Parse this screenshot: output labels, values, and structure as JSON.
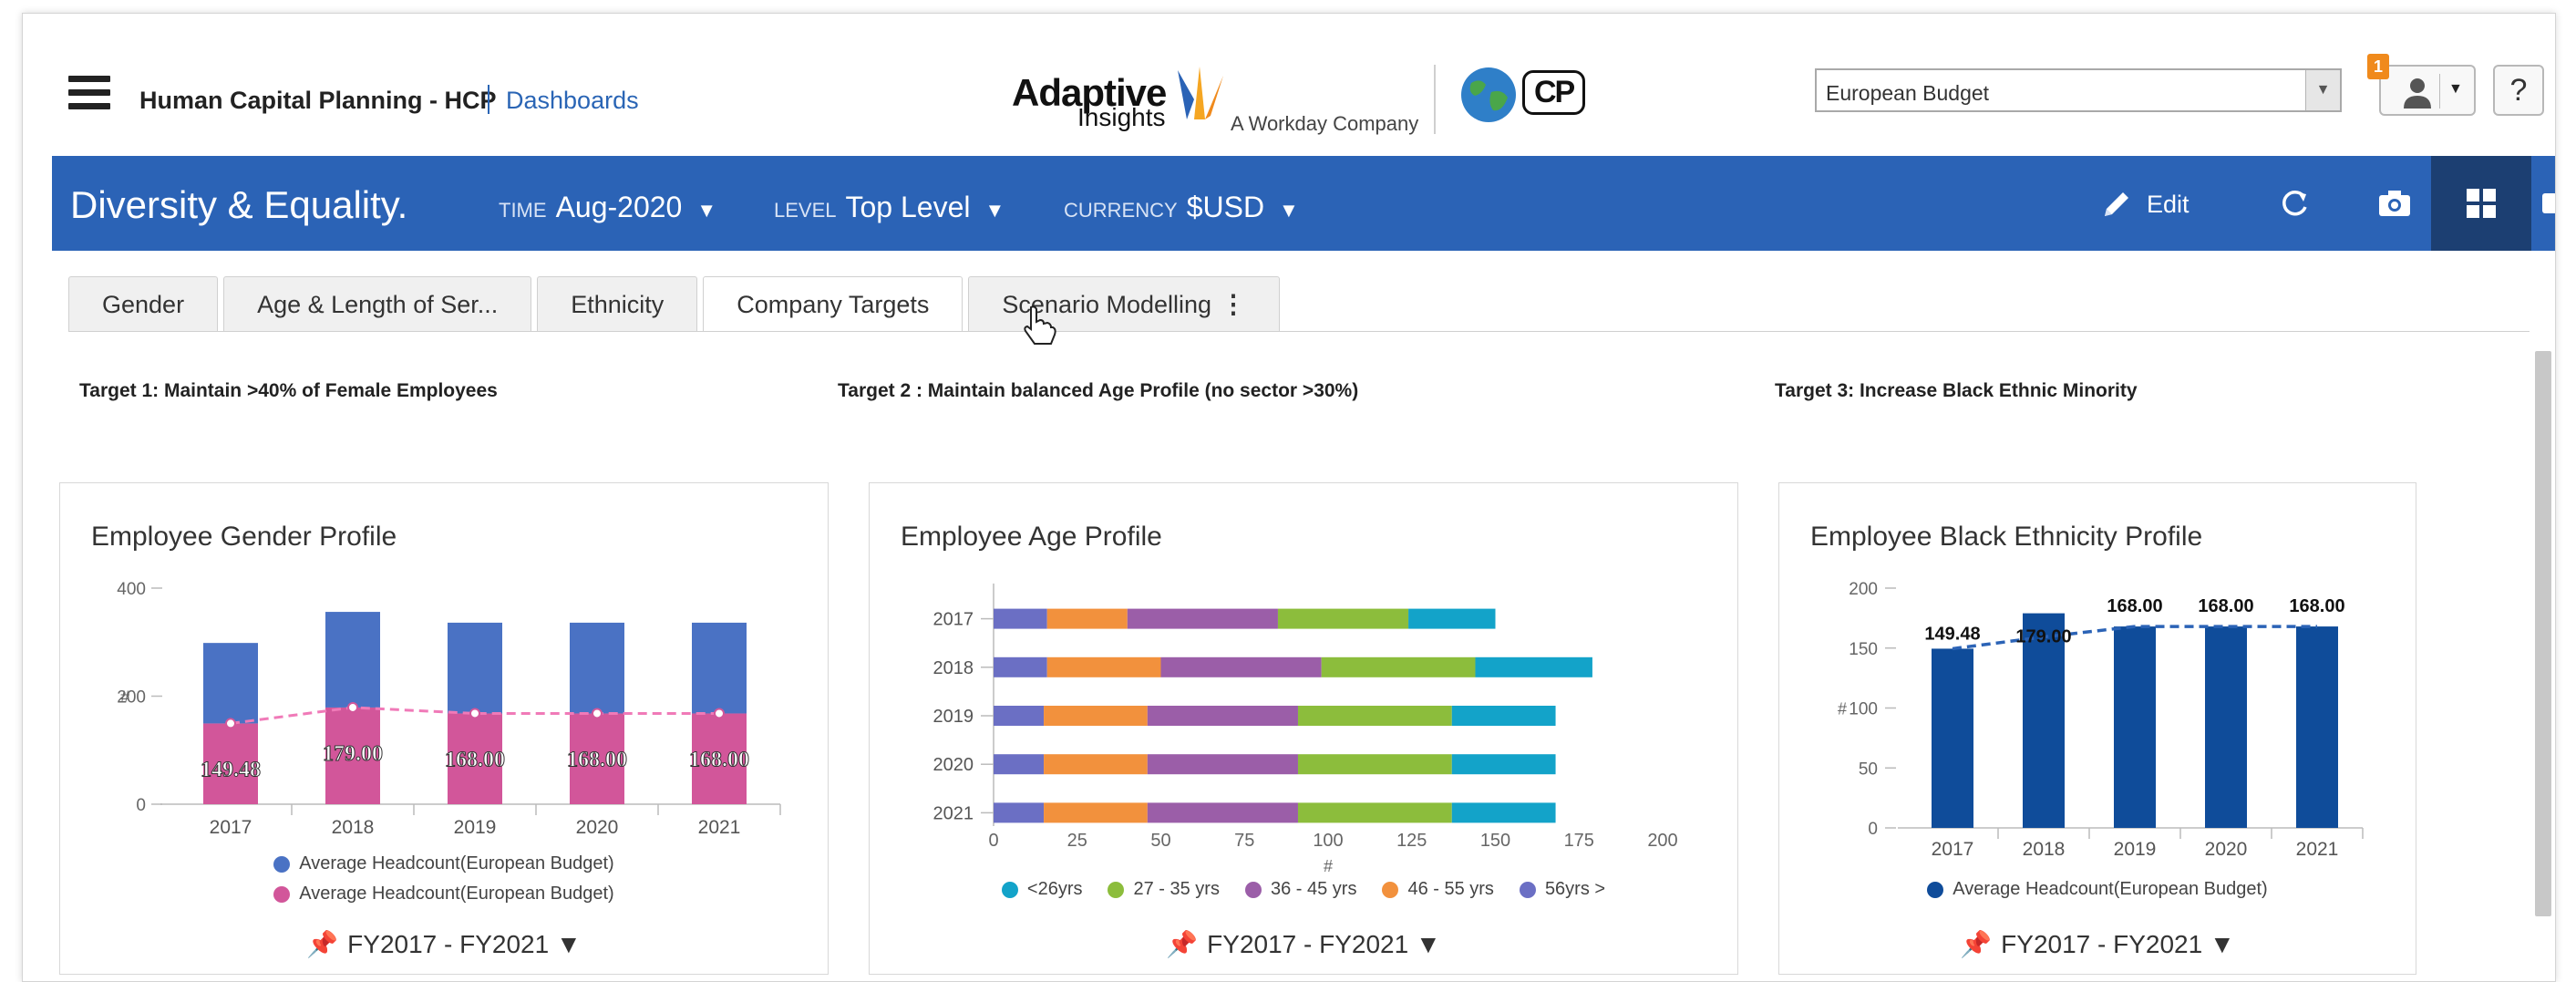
{
  "app": {
    "title": "Human Capital Planning - HCP",
    "dashboards_link": "Dashboards",
    "logo_adaptive": "Adaptive",
    "logo_insights": "Insights",
    "logo_workday": "A Workday Company",
    "hcp_logo": "CP",
    "budget_select": "European Budget",
    "notification_count": "1",
    "help": "?"
  },
  "header": {
    "title": "Diversity & Equality.",
    "time_label": "TIME",
    "time_value": "Aug-2020",
    "level_label": "LEVEL",
    "level_value": "Top Level",
    "currency_label": "CURRENCY",
    "currency_value": "$USD",
    "edit_label": "Edit"
  },
  "tabs": [
    {
      "label": "Gender"
    },
    {
      "label": "Age & Length of Ser..."
    },
    {
      "label": "Ethnicity"
    },
    {
      "label": "Company Targets"
    },
    {
      "label": "Scenario Modelling"
    }
  ],
  "targets": [
    "Target 1: Maintain >40% of Female Employees",
    "Target 2 : Maintain balanced Age Profile (no sector >30%)",
    "Target 3: Increase Black Ethnic Minority"
  ],
  "colors": {
    "brand_blue": "#2b63b6",
    "female_pink": "#d2569a",
    "male_blue": "#4a72c4",
    "navy": "#0f4c9a"
  },
  "chart_data": [
    {
      "type": "bar",
      "title": "Employee Gender Profile",
      "categories": [
        "2017",
        "2018",
        "2019",
        "2020",
        "2021"
      ],
      "ylim": [
        0,
        400
      ],
      "yticks": [
        "0",
        "200",
        "400"
      ],
      "ylabel": "#",
      "series": [
        {
          "name": "Average Headcount(European Budget)",
          "color": "#4a72c4",
          "values": [
            149,
            177,
            168,
            168,
            168
          ]
        },
        {
          "name": "Average Headcount(European Budget)",
          "color": "#d2569a",
          "values": [
            149.48,
            179.0,
            168.0,
            168.0,
            168.0
          ]
        }
      ],
      "data_labels": [
        "149.48",
        "179.00",
        "168.00",
        "168.00",
        "168.00"
      ],
      "period": "FY2017 - FY2021"
    },
    {
      "type": "bar",
      "title": "Employee Age Profile",
      "orientation": "horizontal",
      "categories": [
        "2017",
        "2018",
        "2019",
        "2020",
        "2021"
      ],
      "xlim": [
        0,
        200
      ],
      "xticks": [
        "0",
        "25",
        "50",
        "75",
        "100",
        "125",
        "150",
        "175",
        "200"
      ],
      "xlabel": "#",
      "series": [
        {
          "name": "56yrs >",
          "color": "#6b6fc4",
          "values": [
            16,
            16,
            15,
            15,
            15
          ]
        },
        {
          "name": "46 - 55 yrs",
          "color": "#f2913d",
          "values": [
            24,
            34,
            31,
            31,
            31
          ]
        },
        {
          "name": "36 - 45 yrs",
          "color": "#9b5ea8",
          "values": [
            45,
            48,
            45,
            45,
            45
          ]
        },
        {
          "name": "27 - 35 yrs",
          "color": "#8cbd3c",
          "values": [
            39,
            46,
            46,
            46,
            46
          ]
        },
        {
          "name": "<26yrs",
          "color": "#13a3c9",
          "values": [
            26,
            35,
            31,
            31,
            31
          ]
        }
      ],
      "legend": [
        "<26yrs",
        "27 - 35 yrs",
        "36 - 45 yrs",
        "46 - 55 yrs",
        "56yrs >"
      ],
      "period": "FY2017 - FY2021"
    },
    {
      "type": "bar",
      "title": "Employee Black Ethnicity Profile",
      "categories": [
        "2017",
        "2018",
        "2019",
        "2020",
        "2021"
      ],
      "ylim": [
        0,
        200
      ],
      "yticks": [
        "0",
        "50",
        "100",
        "150",
        "200"
      ],
      "ylabel": "#",
      "series": [
        {
          "name": "Average Headcount(European Budget)",
          "color": "#0f4c9a",
          "values": [
            149.48,
            179.0,
            168.0,
            168.0,
            168.0
          ]
        }
      ],
      "data_labels": [
        "149.48",
        "179.00",
        "168.00",
        "168.00",
        "168.00"
      ],
      "period": "FY2017 - FY2021"
    }
  ]
}
